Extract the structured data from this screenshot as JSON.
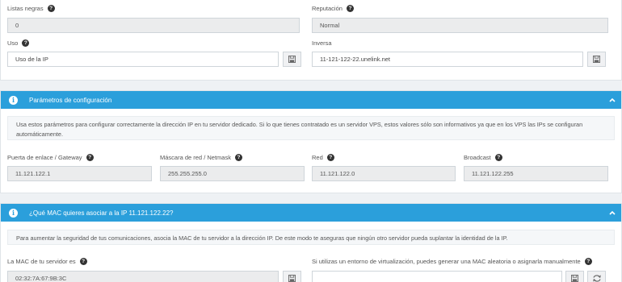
{
  "network": {
    "blacklists": {
      "label": "Listas negras",
      "value": "0"
    },
    "reputation": {
      "label": "Reputación",
      "value": "Normal"
    },
    "usage": {
      "label": "Uso",
      "value": "Uso de la IP"
    },
    "reverse": {
      "label": "Inversa",
      "value": "11-121-122-22.unelink.net"
    }
  },
  "config_panel": {
    "title": "Parámetros de configuración",
    "notice": "Usa estos parámetros para configurar correctamente la dirección IP en tu servidor dedicado. Si lo que tienes contratado es un servidor VPS, estos valores sólo son informativos ya que en los VPS las IPs se configuran automáticamente.",
    "gateway": {
      "label": "Puerta de enlace / Gateway",
      "value": "11.121.122.1"
    },
    "netmask": {
      "label": "Máscara de red / Netmask",
      "value": "255.255.255.0"
    },
    "network": {
      "label": "Red",
      "value": "11.121.122.0"
    },
    "broadcast": {
      "label": "Broadcast",
      "value": "11.121.122.255"
    }
  },
  "mac_panel": {
    "title": "¿Qué MAC quieres asociar a la IP 11.121.122.22?",
    "notice": "Para aumentar la seguridad de tus comunicaciones, asocia la MAC de tu servidor a la dirección IP. De este modo te aseguras que ningún otro servidor pueda suplantar la identidad de la IP.",
    "server_mac": {
      "label": "La MAC de tu servidor es",
      "value": "02:32:7A:67:9B:3C"
    },
    "virtual_mac": {
      "label": "Si utilizas un entorno de virtualización, puedes generar una MAC aleatoria o asignarla manualmente",
      "value": ""
    }
  },
  "icons": {
    "help": "?",
    "info": "i",
    "save": "floppy-disk-icon",
    "random": "refresh-icon",
    "collapse": "chevron-up-icon"
  },
  "colors": {
    "accent": "#2b9fdb",
    "background": "#eef1f4"
  }
}
